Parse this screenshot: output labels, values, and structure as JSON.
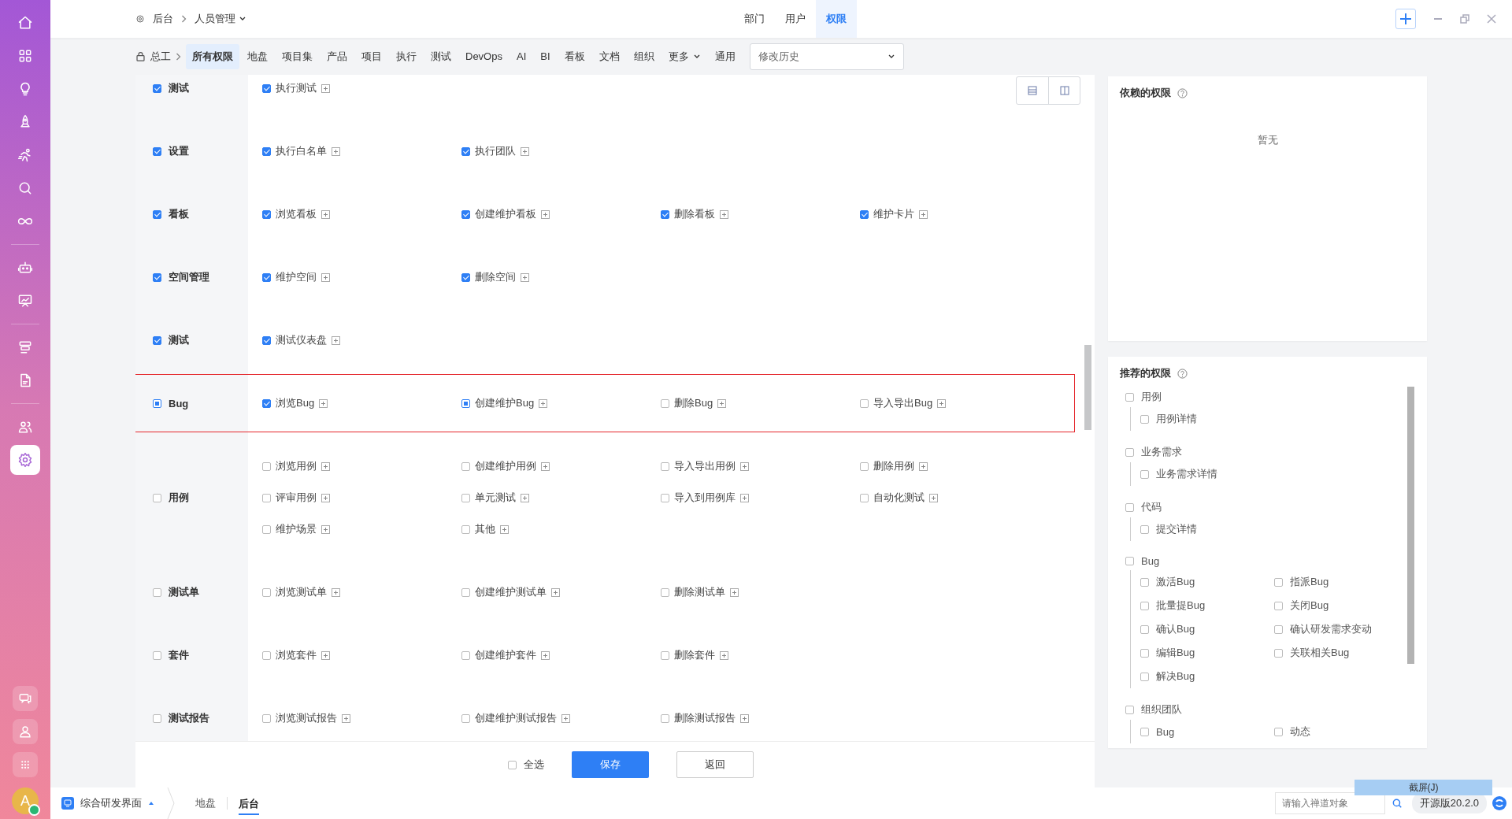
{
  "sidebar": {
    "items": [
      {
        "selected": false
      },
      {
        "selected": false
      },
      {
        "selected": false
      },
      {
        "selected": false
      },
      {
        "selected": false
      },
      {
        "selected": false
      },
      {
        "selected": false
      },
      {
        "selected": false
      },
      {
        "selected": false
      },
      {
        "selected": false
      },
      {
        "selected": false
      },
      {
        "selected": false
      },
      {
        "selected": true
      }
    ],
    "avatar": "A"
  },
  "breadcrumb": {
    "root": "后台",
    "current": "人员管理"
  },
  "top_tabs": [
    {
      "label": "部门",
      "selected": false
    },
    {
      "label": "用户",
      "selected": false
    },
    {
      "label": "权限",
      "selected": true
    }
  ],
  "subnav": {
    "root": "总工",
    "items": [
      {
        "label": "所有权限",
        "selected": true,
        "caret": false
      },
      {
        "label": "地盘",
        "selected": false,
        "caret": false
      },
      {
        "label": "项目集",
        "selected": false,
        "caret": false
      },
      {
        "label": "产品",
        "selected": false,
        "caret": false
      },
      {
        "label": "项目",
        "selected": false,
        "caret": false
      },
      {
        "label": "执行",
        "selected": false,
        "caret": false
      },
      {
        "label": "测试",
        "selected": false,
        "caret": false
      },
      {
        "label": "DevOps",
        "selected": false,
        "caret": false
      },
      {
        "label": "AI",
        "selected": false,
        "caret": false
      },
      {
        "label": "BI",
        "selected": false,
        "caret": false
      },
      {
        "label": "看板",
        "selected": false,
        "caret": false
      },
      {
        "label": "文档",
        "selected": false,
        "caret": false
      },
      {
        "label": "组织",
        "selected": false,
        "caret": false
      },
      {
        "label": "更多",
        "selected": false,
        "caret": true
      },
      {
        "label": "通用",
        "selected": false,
        "caret": false
      }
    ],
    "history_select": "修改历史"
  },
  "groups": [
    {
      "label": "测试",
      "checked": true,
      "partial": false,
      "highlighted": false,
      "permissions": [
        {
          "label": "执行测试",
          "checked": true,
          "partial": false
        }
      ]
    },
    {
      "label": "设置",
      "checked": true,
      "partial": false,
      "highlighted": false,
      "permissions": [
        {
          "label": "执行白名单",
          "checked": true,
          "partial": false
        },
        {
          "label": "执行团队",
          "checked": true,
          "partial": false
        }
      ]
    },
    {
      "label": "看板",
      "checked": true,
      "partial": false,
      "highlighted": false,
      "permissions": [
        {
          "label": "浏览看板",
          "checked": true,
          "partial": false
        },
        {
          "label": "创建维护看板",
          "checked": true,
          "partial": false
        },
        {
          "label": "删除看板",
          "checked": true,
          "partial": false
        },
        {
          "label": "维护卡片",
          "checked": true,
          "partial": false
        }
      ]
    },
    {
      "label": "空间管理",
      "checked": true,
      "partial": false,
      "highlighted": false,
      "permissions": [
        {
          "label": "维护空间",
          "checked": true,
          "partial": false
        },
        {
          "label": "删除空间",
          "checked": true,
          "partial": false
        }
      ]
    },
    {
      "label": "测试",
      "checked": true,
      "partial": false,
      "highlighted": false,
      "permissions": [
        {
          "label": "测试仪表盘",
          "checked": true,
          "partial": false
        }
      ]
    },
    {
      "label": "Bug",
      "checked": false,
      "partial": true,
      "highlighted": true,
      "permissions": [
        {
          "label": "浏览Bug",
          "checked": true,
          "partial": false
        },
        {
          "label": "创建维护Bug",
          "checked": false,
          "partial": true
        },
        {
          "label": "删除Bug",
          "checked": false,
          "partial": false
        },
        {
          "label": "导入导出Bug",
          "checked": false,
          "partial": false
        }
      ]
    },
    {
      "label": "用例",
      "checked": false,
      "partial": false,
      "highlighted": false,
      "permissions": [
        {
          "label": "浏览用例",
          "checked": false,
          "partial": false
        },
        {
          "label": "创建维护用例",
          "checked": false,
          "partial": false
        },
        {
          "label": "导入导出用例",
          "checked": false,
          "partial": false
        },
        {
          "label": "删除用例",
          "checked": false,
          "partial": false
        },
        {
          "label": "评审用例",
          "checked": false,
          "partial": false
        },
        {
          "label": "单元测试",
          "checked": false,
          "partial": false
        },
        {
          "label": "导入到用例库",
          "checked": false,
          "partial": false
        },
        {
          "label": "自动化测试",
          "checked": false,
          "partial": false
        },
        {
          "label": "维护场景",
          "checked": false,
          "partial": false
        },
        {
          "label": "其他",
          "checked": false,
          "partial": false
        }
      ]
    },
    {
      "label": "测试单",
      "checked": false,
      "partial": false,
      "highlighted": false,
      "permissions": [
        {
          "label": "浏览测试单",
          "checked": false,
          "partial": false
        },
        {
          "label": "创建维护测试单",
          "checked": false,
          "partial": false
        },
        {
          "label": "删除测试单",
          "checked": false,
          "partial": false
        }
      ]
    },
    {
      "label": "套件",
      "checked": false,
      "partial": false,
      "highlighted": false,
      "permissions": [
        {
          "label": "浏览套件",
          "checked": false,
          "partial": false
        },
        {
          "label": "创建维护套件",
          "checked": false,
          "partial": false
        },
        {
          "label": "删除套件",
          "checked": false,
          "partial": false
        }
      ]
    },
    {
      "label": "测试报告",
      "checked": false,
      "partial": false,
      "highlighted": false,
      "permissions": [
        {
          "label": "浏览测试报告",
          "checked": false,
          "partial": false
        },
        {
          "label": "创建维护测试报告",
          "checked": false,
          "partial": false
        },
        {
          "label": "删除测试报告",
          "checked": false,
          "partial": false
        }
      ]
    }
  ],
  "actions": {
    "select_all": {
      "label": "全选",
      "checked": false
    },
    "save": "保存",
    "back": "返回"
  },
  "dependent": {
    "title": "依赖的权限",
    "empty": "暂无"
  },
  "recommended": {
    "title": "推荐的权限",
    "groups": [
      {
        "label": "用例",
        "checked": false,
        "children": [
          {
            "label": "用例详情",
            "checked": false
          }
        ]
      },
      {
        "label": "业务需求",
        "checked": false,
        "children": [
          {
            "label": "业务需求详情",
            "checked": false
          }
        ]
      },
      {
        "label": "代码",
        "checked": false,
        "children": [
          {
            "label": "提交详情",
            "checked": false
          }
        ]
      },
      {
        "label": "Bug",
        "checked": false,
        "children": [
          {
            "label": "激活Bug",
            "checked": false
          },
          {
            "label": "指派Bug",
            "checked": false
          },
          {
            "label": "批量提Bug",
            "checked": false
          },
          {
            "label": "关闭Bug",
            "checked": false
          },
          {
            "label": "确认Bug",
            "checked": false
          },
          {
            "label": "确认研发需求变动",
            "checked": false
          },
          {
            "label": "编辑Bug",
            "checked": false
          },
          {
            "label": "关联相关Bug",
            "checked": false
          },
          {
            "label": "解决Bug",
            "checked": false
          }
        ]
      },
      {
        "label": "组织团队",
        "checked": false,
        "children": [
          {
            "label": "Bug",
            "checked": false
          },
          {
            "label": "动态",
            "checked": false
          }
        ]
      }
    ]
  },
  "taskbar": {
    "app": "综合研发界面",
    "tabs": [
      {
        "label": "地盘",
        "selected": false
      },
      {
        "label": "后台",
        "selected": true
      }
    ],
    "search_placeholder": "请输入禅道对象",
    "version": "开源版20.2.0",
    "tooltip": "截屏(J)"
  }
}
